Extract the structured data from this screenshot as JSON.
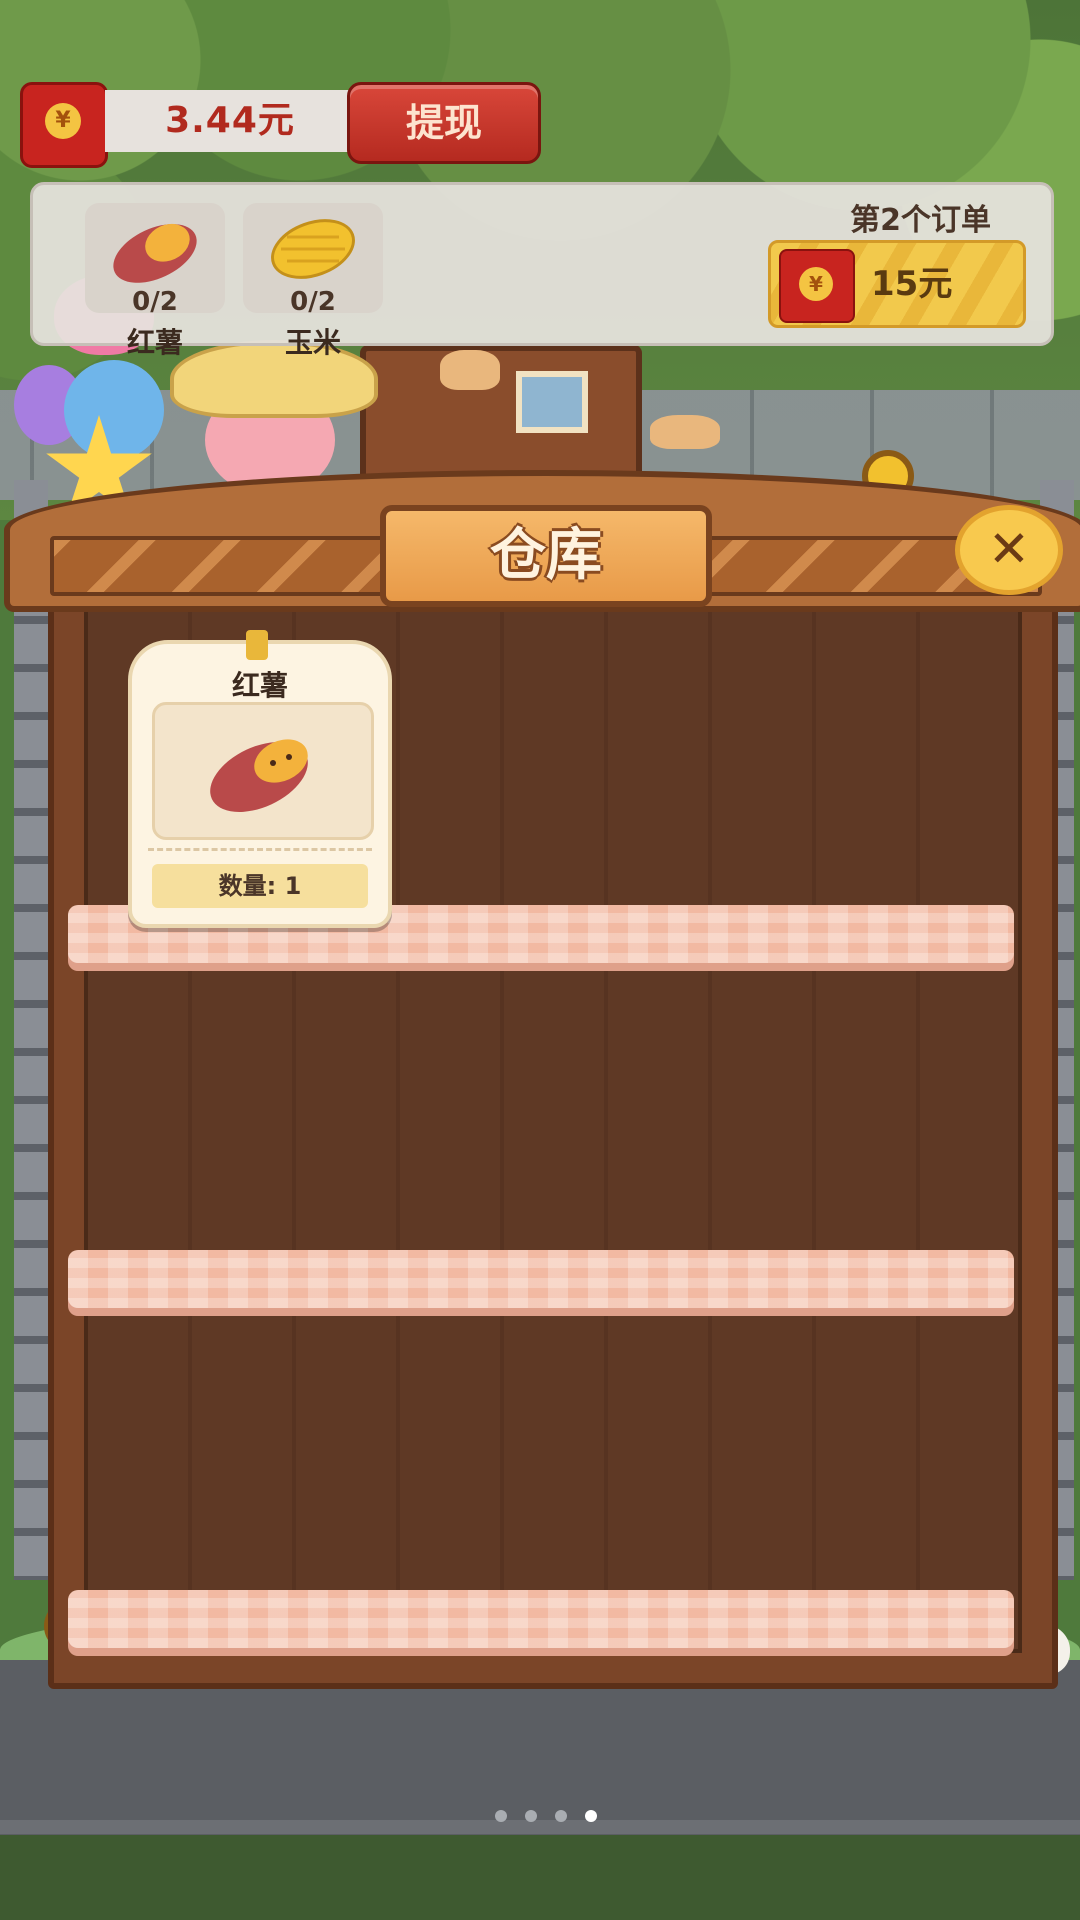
{
  "wallet": {
    "currency_icon": "yuan-coin-icon",
    "coin_glyph": "¥",
    "balance": "3.44元",
    "withdraw_label": "提现"
  },
  "order": {
    "title": "第2个订单",
    "items": [
      {
        "icon": "sweet-potato-icon",
        "progress": "0/2",
        "name": "红薯"
      },
      {
        "icon": "corn-icon",
        "progress": "0/2",
        "name": "玉米"
      }
    ],
    "reward_amount": "15元"
  },
  "warehouse": {
    "title": "仓库",
    "close_glyph": "✕",
    "items": [
      {
        "name": "红薯",
        "icon": "sweet-potato-icon",
        "quantity": "数量: 1"
      }
    ]
  },
  "pager": {
    "count": 4,
    "active_index": 3
  },
  "colors": {
    "accent_red": "#c8241f",
    "gold": "#f2c94c",
    "wood": "#7b4528",
    "shelf_pink": "#f2b9a2"
  }
}
